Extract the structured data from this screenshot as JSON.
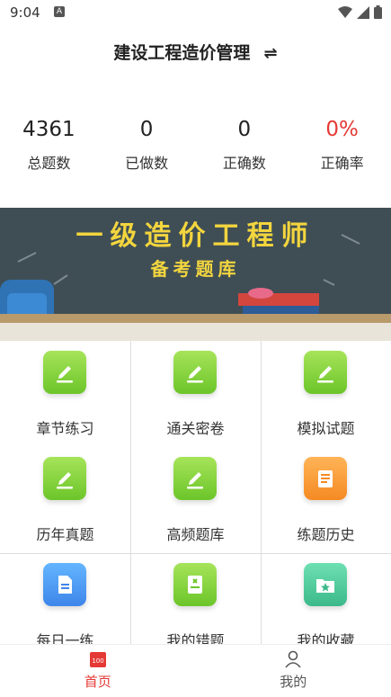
{
  "status": {
    "time": "9:04",
    "app_icon_letter": "A"
  },
  "header": {
    "title": "建设工程造价管理",
    "switch_symbol": "⇌"
  },
  "stats": [
    {
      "value": "4361",
      "label": "总题数",
      "color": "#222222"
    },
    {
      "value": "0",
      "label": "已做数",
      "color": "#222222"
    },
    {
      "value": "0",
      "label": "正确数",
      "color": "#222222"
    },
    {
      "value": "0%",
      "label": "正确率",
      "color": "#e53935"
    }
  ],
  "banner": {
    "line1": "一级造价工程师",
    "line2": "备考题库"
  },
  "menu": [
    {
      "label": "章节练习",
      "icon": "pencil-icon",
      "color": "green"
    },
    {
      "label": "通关密卷",
      "icon": "pencil-icon",
      "color": "green"
    },
    {
      "label": "模拟试题",
      "icon": "pencil-icon",
      "color": "green"
    },
    {
      "label": "历年真题",
      "icon": "pencil-icon",
      "color": "green"
    },
    {
      "label": "高频题库",
      "icon": "pencil-icon",
      "color": "green"
    },
    {
      "label": "练题历史",
      "icon": "scroll-icon",
      "color": "orange"
    },
    {
      "label": "每日一练",
      "icon": "document-icon",
      "color": "blue"
    },
    {
      "label": "我的错题",
      "icon": "error-book-icon",
      "color": "green"
    },
    {
      "label": "我的收藏",
      "icon": "star-folder-icon",
      "color": "teal"
    }
  ],
  "tabs": [
    {
      "label": "首页",
      "icon": "home-calendar-icon",
      "active": true,
      "badge": "100"
    },
    {
      "label": "我的",
      "icon": "person-icon",
      "active": false
    }
  ],
  "colors": {
    "accent_red": "#e53935",
    "banner_text": "#f3d53e"
  }
}
